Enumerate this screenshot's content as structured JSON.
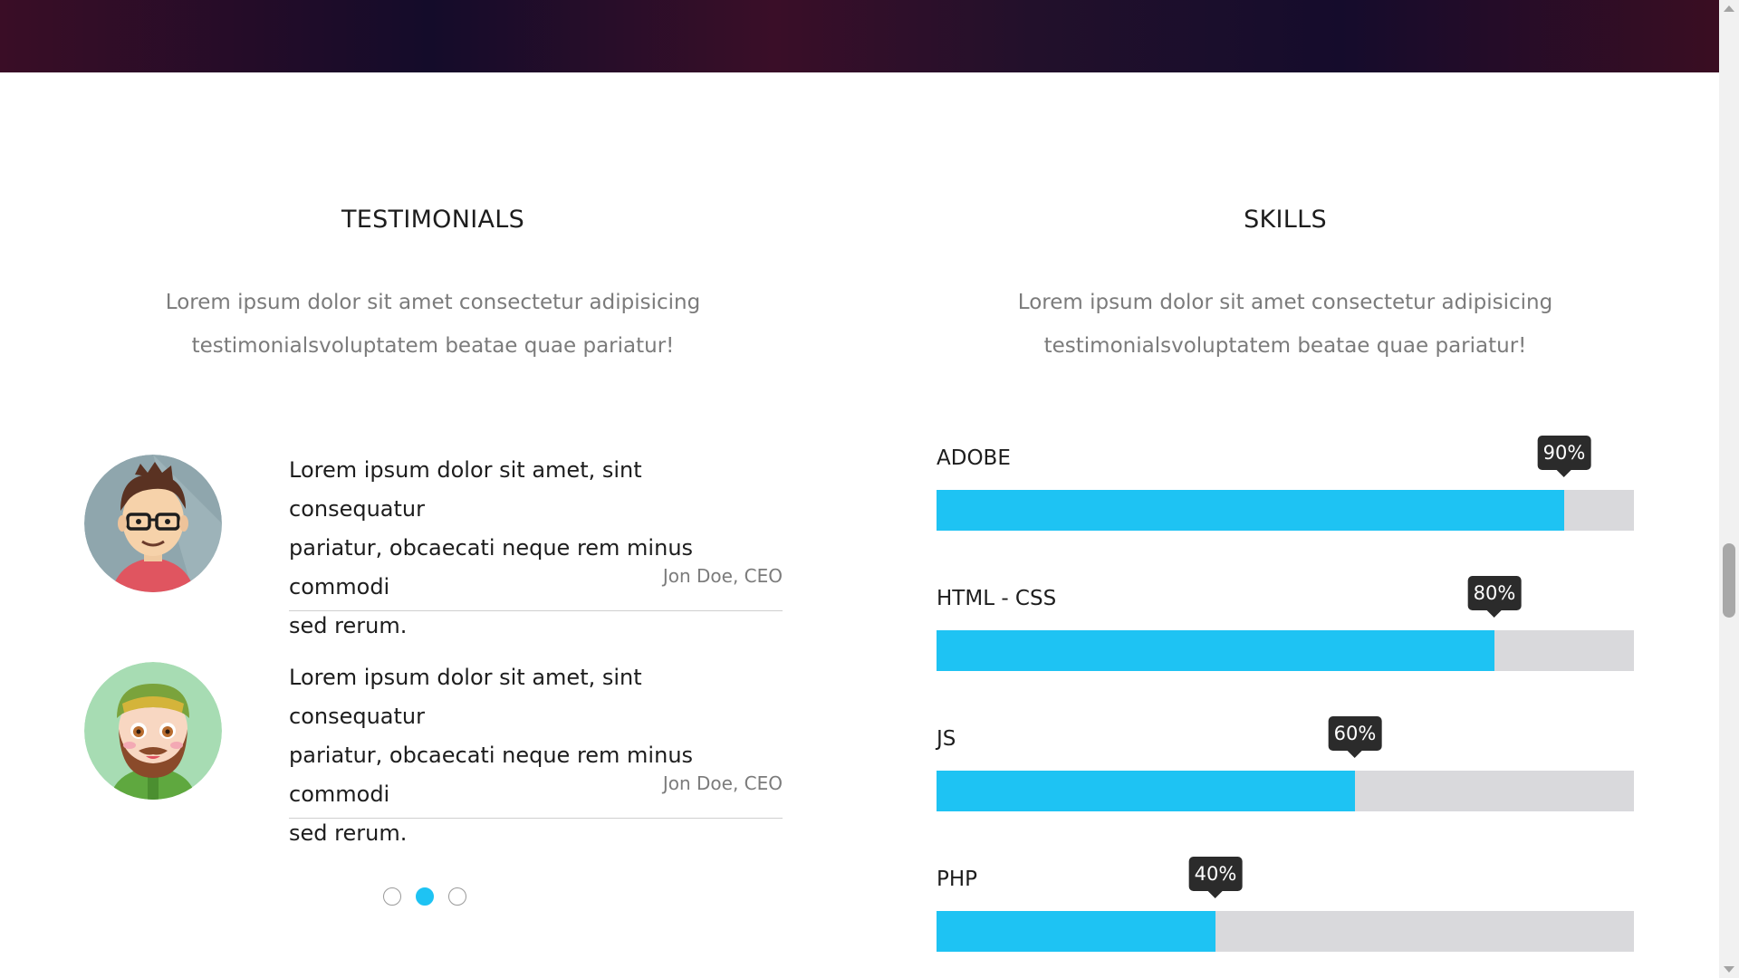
{
  "testimonials_section": {
    "title": "TESTIMONIALS",
    "description_line1": "Lorem ipsum dolor sit amet consectetur adipisicing",
    "description_line2": "testimonialsvoluptatem beatae quae pariatur!",
    "items": [
      {
        "quote_line1": "Lorem ipsum dolor sit amet, sint consequatur",
        "quote_line2": "pariatur, obcaecati neque rem minus commodi",
        "quote_line3": "sed rerum.",
        "author": "Jon Doe, CEO",
        "avatar_icon": "man-with-glasses-avatar-icon"
      },
      {
        "quote_line1": "Lorem ipsum dolor sit amet, sint consequatur",
        "quote_line2": "pariatur, obcaecati neque rem minus commodi",
        "quote_line3": "sed rerum.",
        "author": "Jon Doe, CEO",
        "avatar_icon": "bearded-man-avatar-icon"
      }
    ],
    "pagination": {
      "count": 3,
      "active_index": 1
    }
  },
  "skills_section": {
    "title": "SKILLS",
    "description_line1": "Lorem ipsum dolor sit amet consectetur adipisicing",
    "description_line2": "testimonialsvoluptatem beatae quae pariatur!",
    "skills": [
      {
        "name": "ADOBE",
        "percent": 90,
        "percent_label": "90%"
      },
      {
        "name": "HTML - CSS",
        "percent": 80,
        "percent_label": "80%"
      },
      {
        "name": "JS",
        "percent": 60,
        "percent_label": "60%"
      },
      {
        "name": "PHP",
        "percent": 40,
        "percent_label": "40%"
      }
    ]
  },
  "colors": {
    "accent": "#1ec3f3",
    "track": "#d9d9dc",
    "tooltip_bg": "#2b2b2b",
    "header_dark": "#1a0c2a",
    "header_wine": "#3a0d26"
  }
}
